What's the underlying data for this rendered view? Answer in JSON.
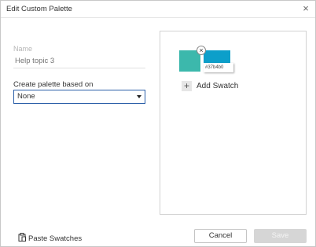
{
  "window": {
    "title": "Edit Custom Palette",
    "close_icon": "close-icon"
  },
  "form": {
    "name_label": "Name",
    "name_placeholder": "Help topic 3",
    "base_label": "Create palette based on",
    "base_selected": "None"
  },
  "preview": {
    "swatches": [
      {
        "color": "#3cb8ac"
      },
      {
        "color": "#0c9fca",
        "hex": "#37b4b0"
      }
    ],
    "remove_icon": "close-icon",
    "add_swatch_label": "Add Swatch",
    "add_icon": "plus-icon"
  },
  "footer": {
    "paste_label": "Paste Swatches",
    "paste_icon": "clipboard-icon",
    "cancel_label": "Cancel",
    "save_label": "Save"
  }
}
